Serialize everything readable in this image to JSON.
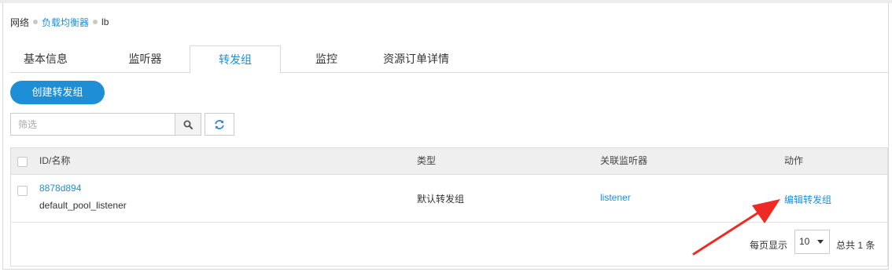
{
  "breadcrumb": {
    "items": [
      "网络",
      "负载均衡器",
      "lb"
    ]
  },
  "tabs": [
    {
      "label": "基本信息",
      "active": false
    },
    {
      "label": "监听器",
      "active": false
    },
    {
      "label": "转发组",
      "active": true
    },
    {
      "label": "监控",
      "active": false
    },
    {
      "label": "资源订单详情",
      "active": false
    }
  ],
  "toolbar": {
    "create_label": "创建转发组",
    "filter_placeholder": "筛选",
    "search_icon": "search-icon",
    "refresh_icon": "refresh-icon"
  },
  "table": {
    "headers": [
      "ID/名称",
      "类型",
      "关联监听器",
      "动作"
    ],
    "rows": [
      {
        "id": "8878d894",
        "name": "default_pool_listener",
        "type": "默认转发组",
        "listener": "listener",
        "action": "编辑转发组"
      }
    ]
  },
  "pagination": {
    "per_page_label": "每页显示",
    "per_page_value": "10",
    "total_label": "总共 1 条"
  },
  "colors": {
    "accent": "#1e8fd6",
    "annotation_arrow": "#ee2a24"
  }
}
